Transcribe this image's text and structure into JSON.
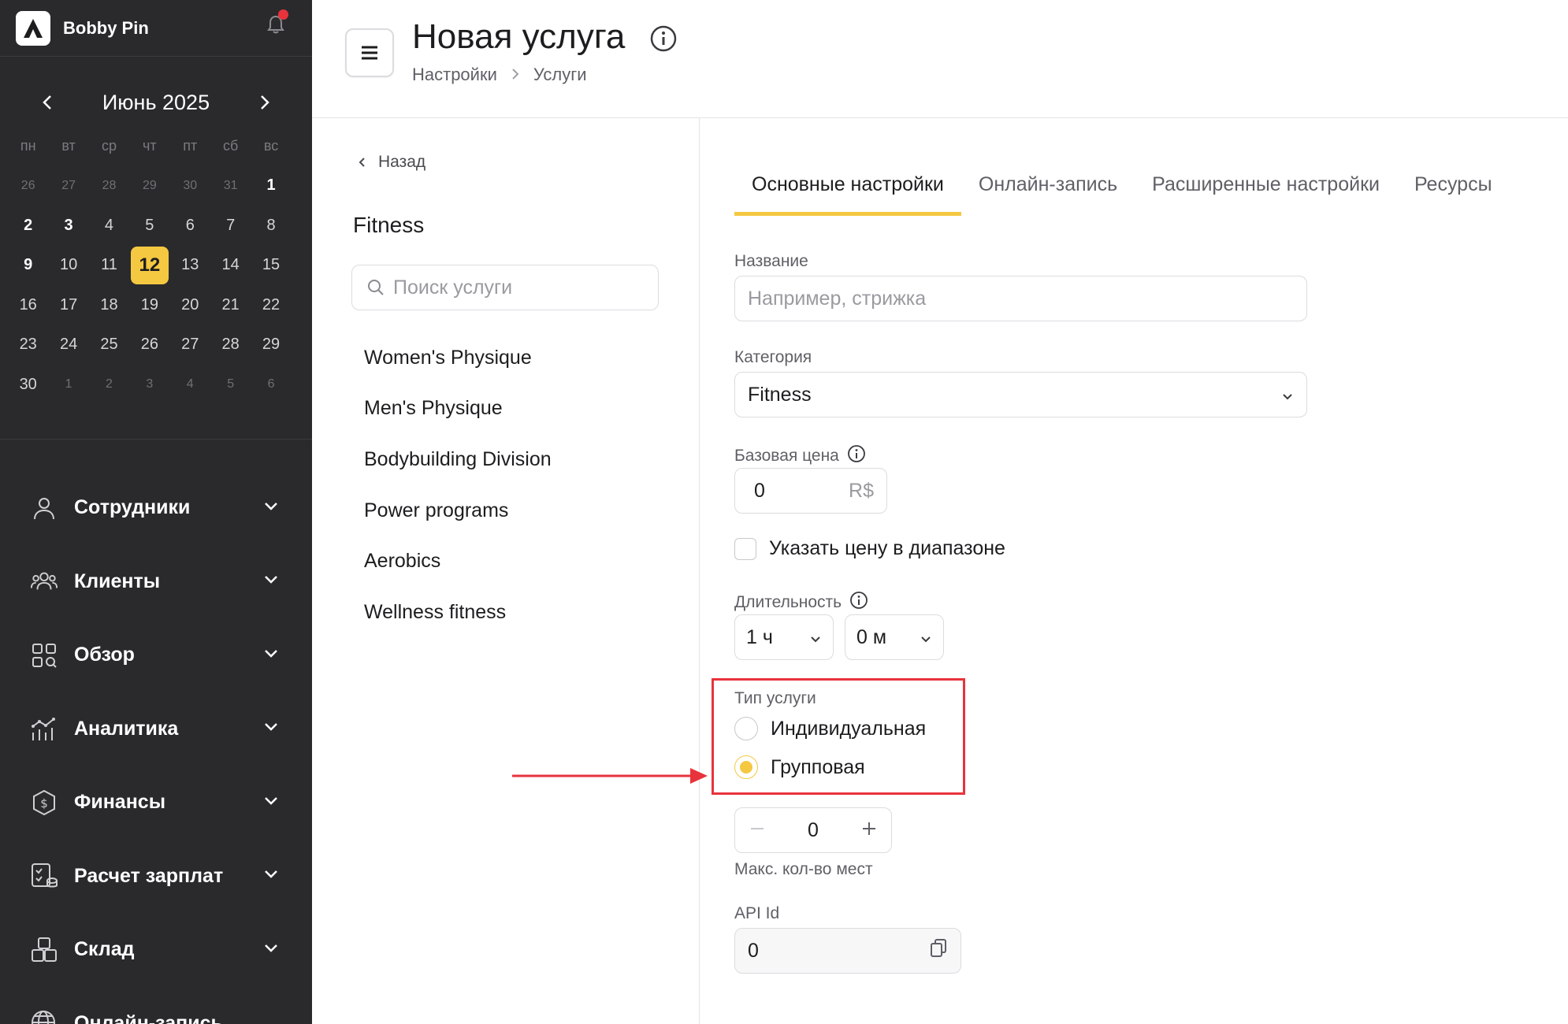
{
  "app": {
    "brand_name": "Bobby Pin"
  },
  "calendar": {
    "title": "Июнь 2025",
    "weekdays": [
      "пн",
      "вт",
      "ср",
      "чт",
      "пт",
      "сб",
      "вс"
    ],
    "days": [
      {
        "n": "26",
        "t": "dim"
      },
      {
        "n": "27",
        "t": "dim"
      },
      {
        "n": "28",
        "t": "dim"
      },
      {
        "n": "29",
        "t": "dim"
      },
      {
        "n": "30",
        "t": "dim"
      },
      {
        "n": "31",
        "t": "dim"
      },
      {
        "n": "1",
        "t": "bold"
      },
      {
        "n": "2",
        "t": "bold"
      },
      {
        "n": "3",
        "t": "bold"
      },
      {
        "n": "4",
        "t": ""
      },
      {
        "n": "5",
        "t": ""
      },
      {
        "n": "6",
        "t": ""
      },
      {
        "n": "7",
        "t": ""
      },
      {
        "n": "8",
        "t": ""
      },
      {
        "n": "9",
        "t": "bold"
      },
      {
        "n": "10",
        "t": ""
      },
      {
        "n": "11",
        "t": ""
      },
      {
        "n": "12",
        "t": "today"
      },
      {
        "n": "13",
        "t": ""
      },
      {
        "n": "14",
        "t": ""
      },
      {
        "n": "15",
        "t": ""
      },
      {
        "n": "16",
        "t": ""
      },
      {
        "n": "17",
        "t": ""
      },
      {
        "n": "18",
        "t": ""
      },
      {
        "n": "19",
        "t": ""
      },
      {
        "n": "20",
        "t": ""
      },
      {
        "n": "21",
        "t": ""
      },
      {
        "n": "22",
        "t": ""
      },
      {
        "n": "23",
        "t": ""
      },
      {
        "n": "24",
        "t": ""
      },
      {
        "n": "25",
        "t": ""
      },
      {
        "n": "26",
        "t": ""
      },
      {
        "n": "27",
        "t": ""
      },
      {
        "n": "28",
        "t": ""
      },
      {
        "n": "29",
        "t": ""
      },
      {
        "n": "30",
        "t": ""
      },
      {
        "n": "1",
        "t": "dim"
      },
      {
        "n": "2",
        "t": "dim"
      },
      {
        "n": "3",
        "t": "dim"
      },
      {
        "n": "4",
        "t": "dim"
      },
      {
        "n": "5",
        "t": "dim"
      },
      {
        "n": "6",
        "t": "dim"
      }
    ]
  },
  "nav": {
    "items": [
      {
        "label": "Сотрудники",
        "icon": "user-icon"
      },
      {
        "label": "Клиенты",
        "icon": "users-icon"
      },
      {
        "label": "Обзор",
        "icon": "grid-icon"
      },
      {
        "label": "Аналитика",
        "icon": "analytics-icon"
      },
      {
        "label": "Финансы",
        "icon": "finance-icon"
      },
      {
        "label": "Расчет зарплат",
        "icon": "payroll-icon"
      },
      {
        "label": "Склад",
        "icon": "warehouse-icon"
      },
      {
        "label": "Онлайн-запись",
        "icon": "globe-icon"
      }
    ]
  },
  "header": {
    "title": "Новая услуга",
    "breadcrumb": [
      "Настройки",
      "Услуги"
    ]
  },
  "services_panel": {
    "back_label": "Назад",
    "category_title": "Fitness",
    "search_placeholder": "Поиск услуги",
    "items": [
      "Women's Physique",
      "Men's Physique",
      "Bodybuilding Division",
      "Power programs",
      "Aerobics",
      "Wellness fitness"
    ]
  },
  "tabs": [
    "Основные настройки",
    "Онлайн-запись",
    "Расширенные настройки",
    "Ресурсы"
  ],
  "form": {
    "name_label": "Название",
    "name_placeholder": "Например, стрижка",
    "category_label": "Категория",
    "category_value": "Fitness",
    "price_label": "Базовая цена",
    "price_value": "0",
    "price_currency": "R$",
    "range_checkbox_label": "Указать цену в диапазоне",
    "duration_label": "Длительность",
    "duration_hours": "1 ч",
    "duration_minutes": "0 м",
    "service_type_label": "Тип услуги",
    "type_individual": "Индивидуальная",
    "type_group": "Групповая",
    "type_selected": "group",
    "max_seats_value": "0",
    "max_seats_label": "Макс. кол-во мест",
    "api_id_label": "API Id",
    "api_id_value": "0"
  },
  "colors": {
    "accent": "#f5c842",
    "sidebar": "#2a2a2c",
    "highlight": "#e8333c"
  }
}
